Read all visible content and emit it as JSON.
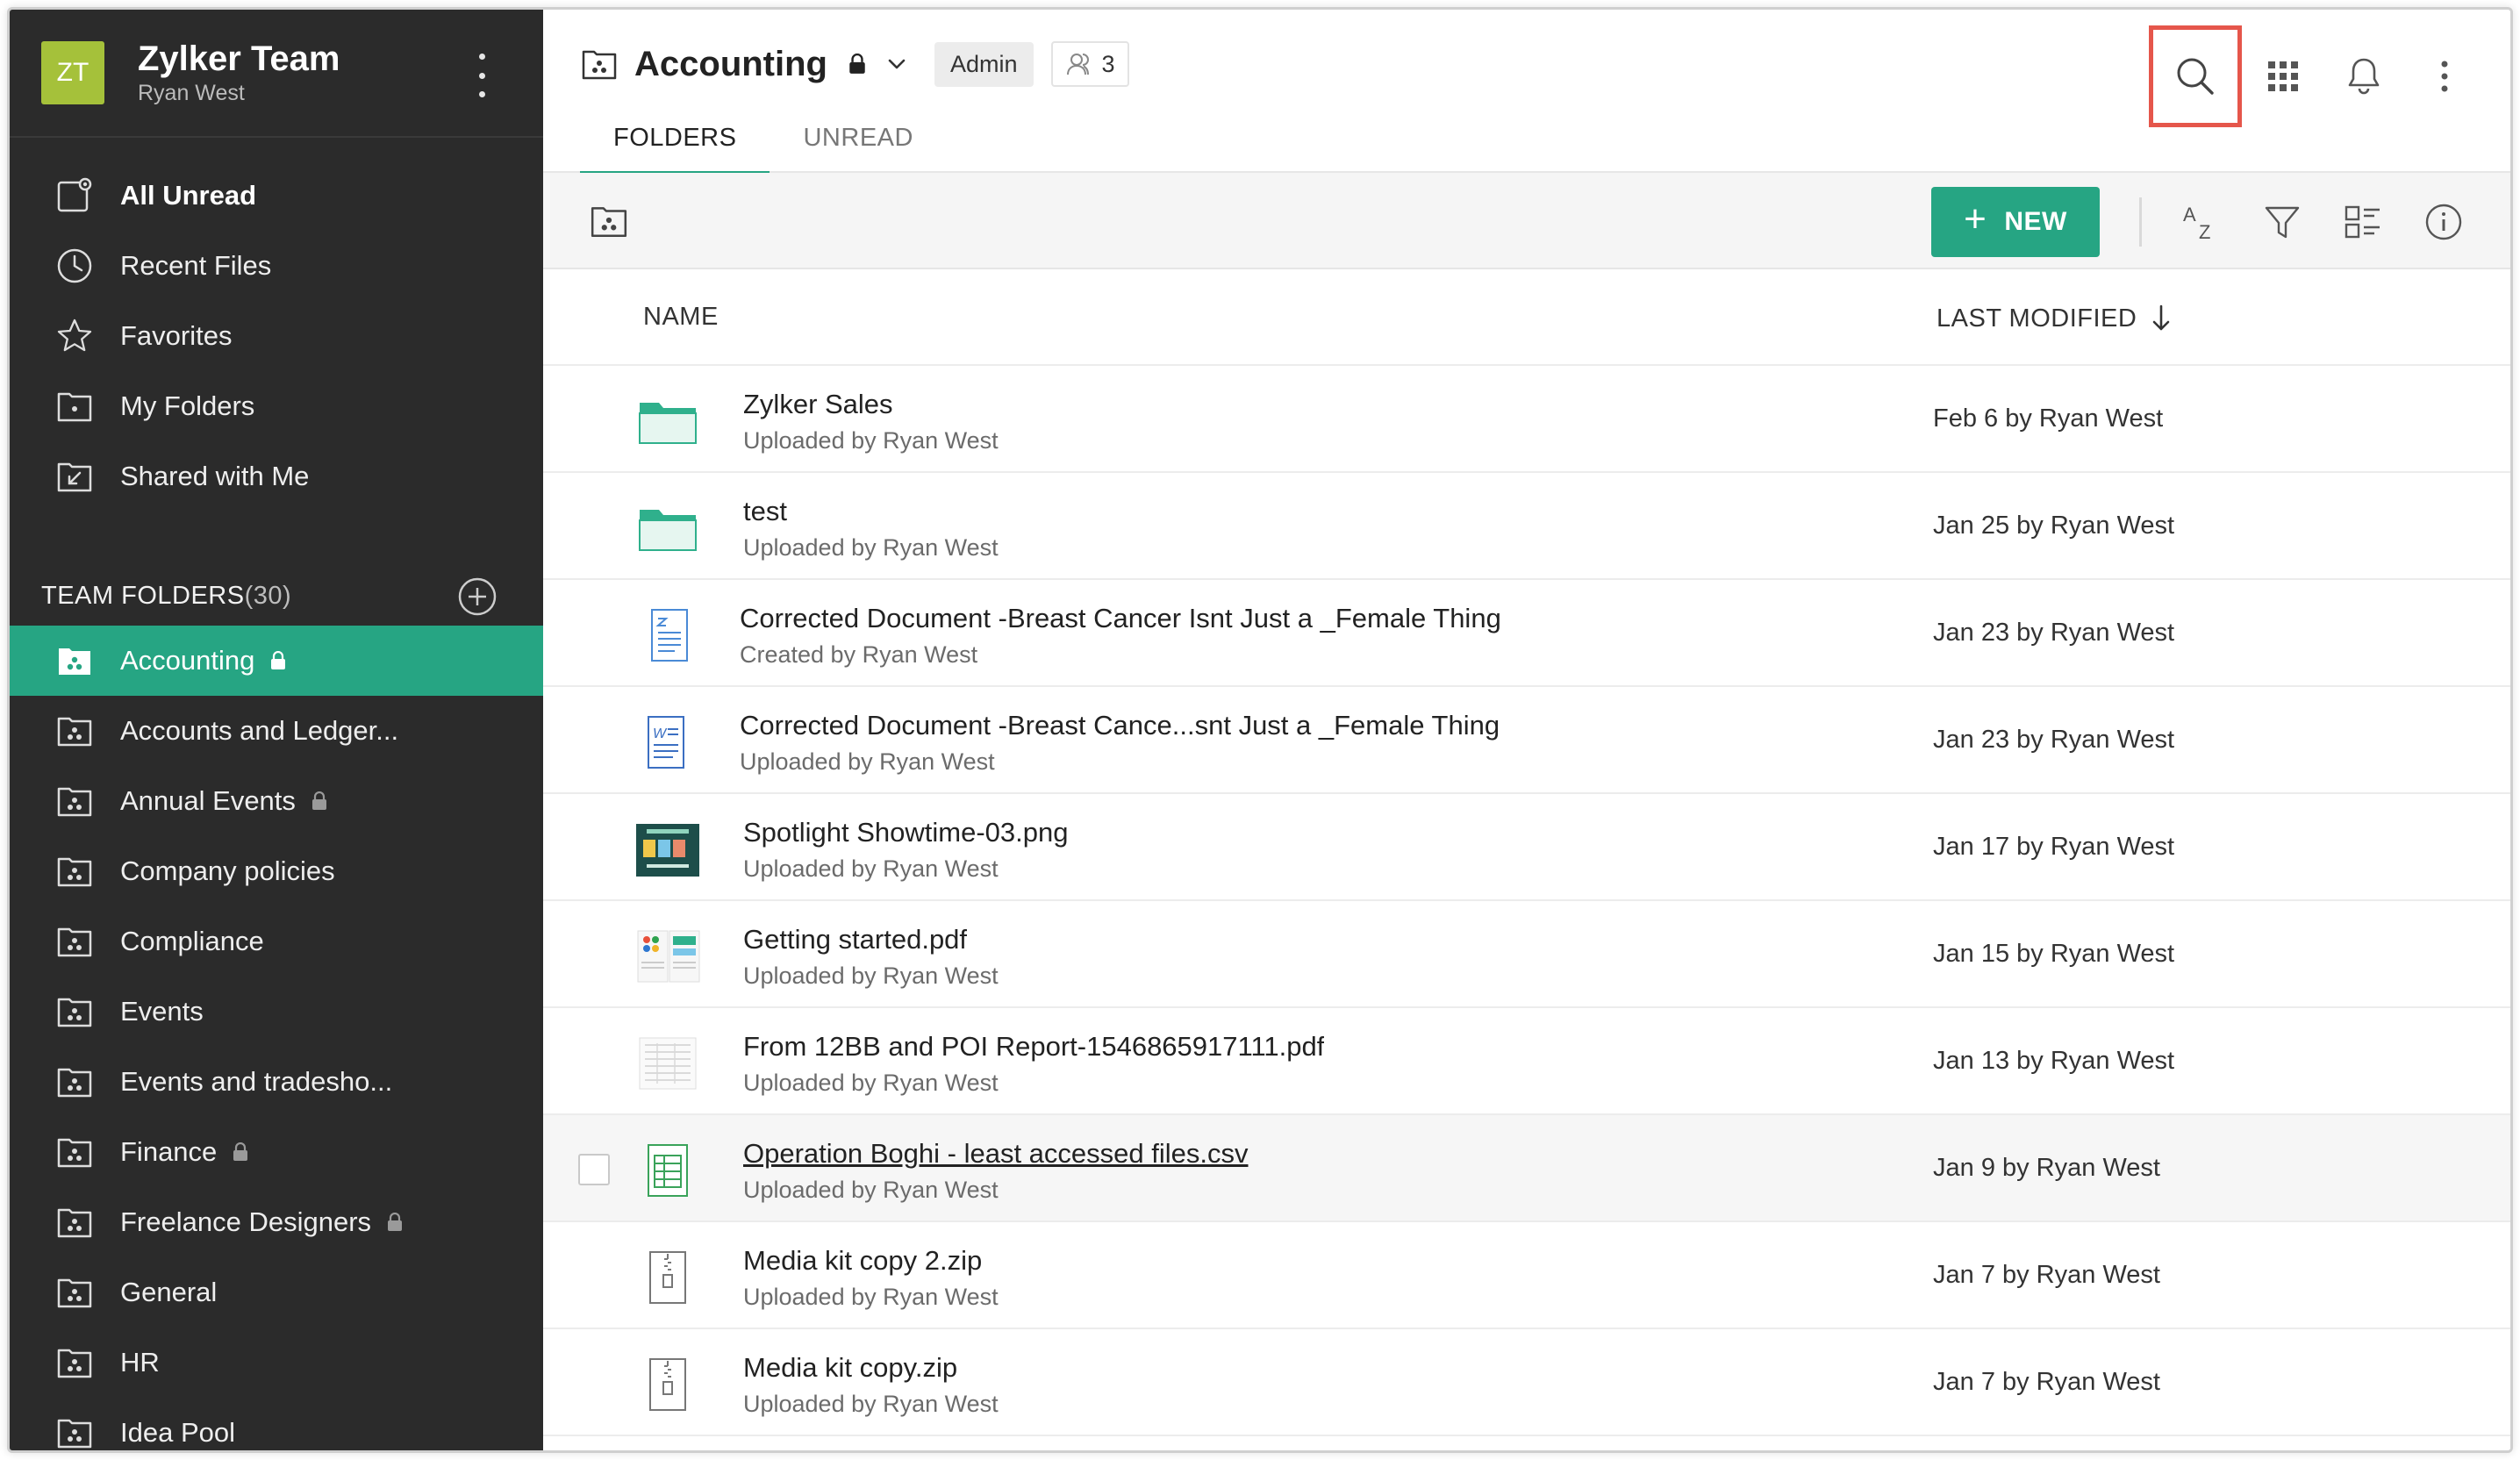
{
  "team": {
    "initials": "ZT",
    "name": "Zylker Team",
    "user": "Ryan West",
    "avatar_color": "#a5c13a"
  },
  "nav": [
    {
      "label": "All Unread",
      "icon": "unread-icon"
    },
    {
      "label": "Recent Files",
      "icon": "clock-icon"
    },
    {
      "label": "Favorites",
      "icon": "star-icon"
    },
    {
      "label": "My Folders",
      "icon": "my-folder-icon"
    },
    {
      "label": "Shared with Me",
      "icon": "shared-folder-icon"
    }
  ],
  "team_folders": {
    "title": "TEAM FOLDERS",
    "count": "(30)",
    "items": [
      {
        "label": "Accounting",
        "locked": true,
        "active": true
      },
      {
        "label": "Accounts and Ledger...",
        "locked": false
      },
      {
        "label": "Annual Events",
        "locked": true
      },
      {
        "label": "Company policies",
        "locked": false
      },
      {
        "label": "Compliance",
        "locked": false
      },
      {
        "label": "Events",
        "locked": false
      },
      {
        "label": "Events and tradesho...",
        "locked": false
      },
      {
        "label": "Finance",
        "locked": true
      },
      {
        "label": "Freelance Designers",
        "locked": true
      },
      {
        "label": "General",
        "locked": false
      },
      {
        "label": "HR",
        "locked": false
      },
      {
        "label": "Idea Pool",
        "locked": false
      }
    ]
  },
  "header": {
    "title": "Accounting",
    "role": "Admin",
    "members": "3",
    "tabs": [
      "FOLDERS",
      "UNREAD"
    ]
  },
  "toolbar": {
    "new_label": "NEW"
  },
  "columns": {
    "name": "NAME",
    "modified": "LAST MODIFIED"
  },
  "files": [
    {
      "name": "Zylker Sales",
      "sub": "Uploaded by Ryan West",
      "modified": "Feb 6 by Ryan West",
      "type": "folder"
    },
    {
      "name": "test",
      "sub": "Uploaded by Ryan West",
      "modified": "Jan 25 by Ryan West",
      "type": "folder"
    },
    {
      "name": "Corrected Document -Breast Cancer Isnt Just a _Female Thing",
      "sub": "Created by Ryan West",
      "modified": "Jan 23 by Ryan West",
      "type": "writer"
    },
    {
      "name": "Corrected Document -Breast Cance...snt Just a _Female Thing",
      "sub": "Uploaded by Ryan West",
      "modified": "Jan 23 by Ryan West",
      "type": "word"
    },
    {
      "name": "Spotlight Showtime-03.png",
      "sub": "Uploaded by Ryan West",
      "modified": "Jan 17 by Ryan West",
      "type": "image"
    },
    {
      "name": "Getting started.pdf",
      "sub": "Uploaded by Ryan West",
      "modified": "Jan 15 by Ryan West",
      "type": "pdf"
    },
    {
      "name": "From 12BB and POI Report-1546865917111.pdf",
      "sub": "Uploaded by Ryan West",
      "modified": "Jan 13 by Ryan West",
      "type": "pdf-doc"
    },
    {
      "name": "Operation Boghi - least accessed files.csv",
      "sub": "Uploaded by Ryan West",
      "modified": "Jan 9 by Ryan West",
      "type": "csv"
    },
    {
      "name": "Media kit copy 2.zip",
      "sub": "Uploaded by Ryan West",
      "modified": "Jan 7 by Ryan West",
      "type": "zip"
    },
    {
      "name": "Media kit copy.zip",
      "sub": "Uploaded by Ryan West",
      "modified": "Jan 7 by Ryan West",
      "type": "zip"
    }
  ],
  "colors": {
    "accent": "#26a583",
    "sidebar": "#2b2b2b",
    "highlight": "#e5564b"
  }
}
